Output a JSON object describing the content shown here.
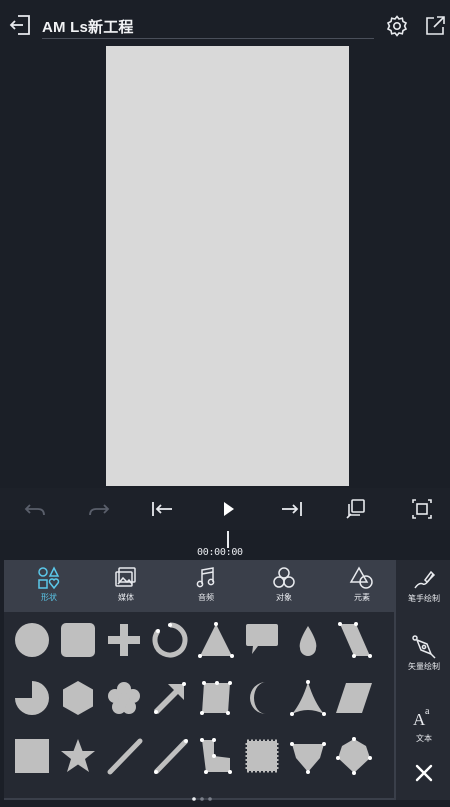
{
  "header": {
    "title": "AM Ls新工程",
    "icons": [
      "exit-icon",
      "gear-icon",
      "share-icon"
    ]
  },
  "timeline": {
    "timecode": "00:00:00"
  },
  "categories": [
    {
      "label": "形状",
      "icon": "shapes-icon",
      "active": true
    },
    {
      "label": "媒体",
      "icon": "media-icon",
      "active": false
    },
    {
      "label": "音频",
      "icon": "music-note-icon",
      "active": false
    },
    {
      "label": "对象",
      "icon": "object-icon",
      "active": false
    },
    {
      "label": "元素",
      "icon": "element-icon",
      "active": false
    }
  ],
  "side_tools": [
    {
      "label": "笔手绘制",
      "icon": "brush-icon"
    },
    {
      "label": "矢量绘制",
      "icon": "vector-pen-icon"
    },
    {
      "label": "文本",
      "icon": "text-icon"
    }
  ],
  "shape_palette": [
    "circle",
    "rounded-square",
    "plus",
    "arc",
    "triangle",
    "speech-bubble",
    "drop",
    "parallelogram-points",
    "pie",
    "hexagon",
    "flower",
    "arrow",
    "trapezoid-points",
    "crescent",
    "curved-triangle",
    "parallelogram",
    "square",
    "star",
    "line",
    "line-points",
    "bracket-shape",
    "stamp-square",
    "pentagon-points",
    "diamond-points"
  ],
  "colors": {
    "background": "#1b1f27",
    "canvas": "#d9d9d9",
    "panel": "#3a3f4a",
    "accent": "#5bc8ea",
    "shape_fill": "#bfbfbf"
  }
}
